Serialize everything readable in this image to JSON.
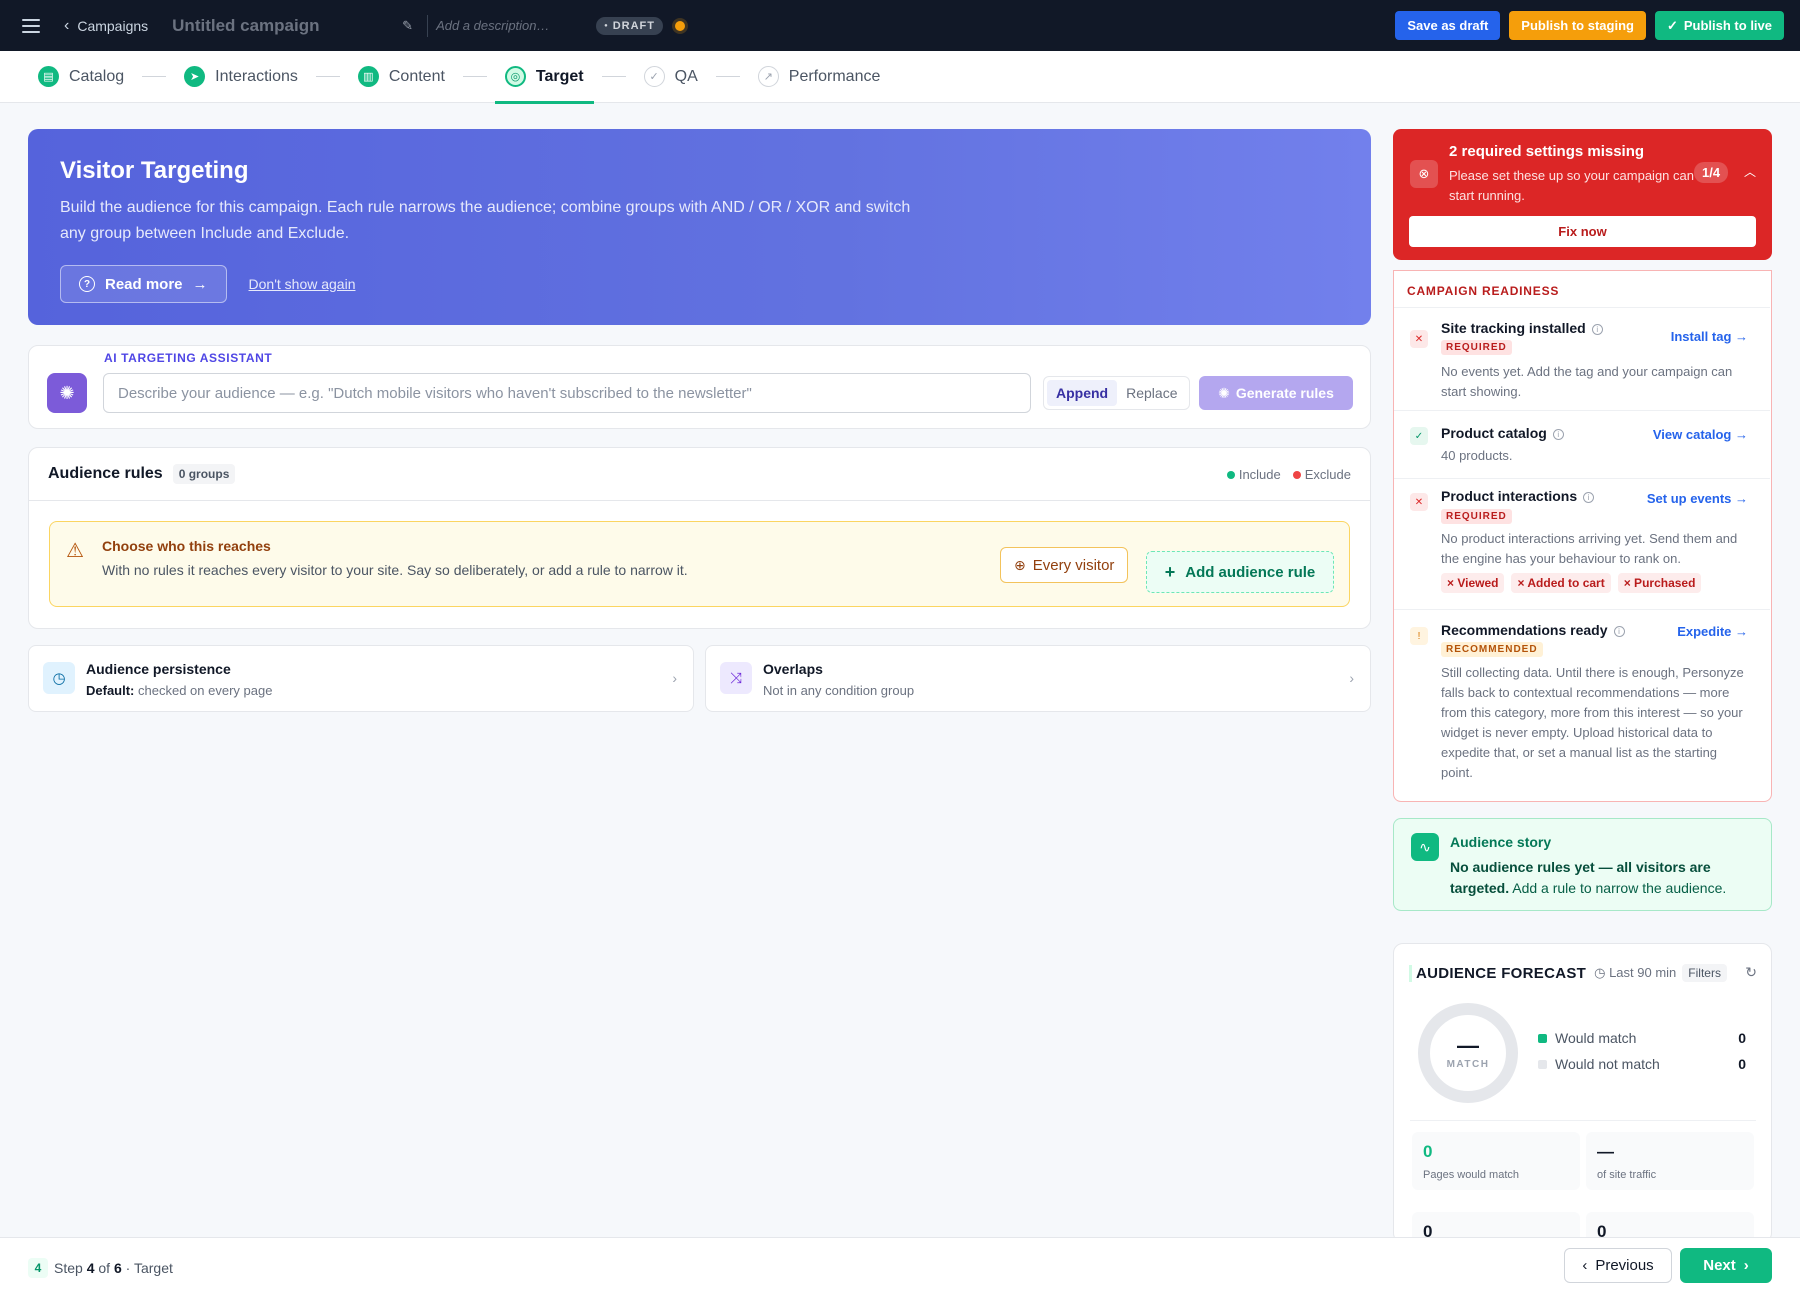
{
  "topbar": {
    "back_label": "Campaigns",
    "campaign_title": "Untitled campaign",
    "description_placeholder": "Add a description…",
    "status_badge": "DRAFT",
    "save_draft": "Save as draft",
    "publish_staging": "Publish to staging",
    "publish_live": "Publish to live"
  },
  "steps": [
    {
      "label": "Catalog",
      "state": "done",
      "icon": "catalog-icon"
    },
    {
      "label": "Interactions",
      "state": "done",
      "icon": "cursor-icon"
    },
    {
      "label": "Content",
      "state": "done",
      "icon": "document-icon"
    },
    {
      "label": "Target",
      "state": "current",
      "icon": "target-icon"
    },
    {
      "label": "QA",
      "state": "future",
      "icon": "check-circle-icon"
    },
    {
      "label": "Performance",
      "state": "future",
      "icon": "chart-icon"
    }
  ],
  "hero": {
    "title": "Visitor Targeting",
    "text": "Build the audience for this campaign. Each rule narrows the audience; combine groups with AND / OR / XOR and switch any group between Include and Exclude.",
    "read_more": "Read more",
    "dont_show": "Don't show again"
  },
  "ai": {
    "label": "AI TARGETING ASSISTANT",
    "placeholder": "Describe your audience — e.g. \"Dutch mobile visitors who haven't subscribed to the newsletter\"",
    "append": "Append",
    "replace": "Replace",
    "generate": "Generate rules"
  },
  "rules": {
    "title": "Audience rules",
    "groups_count": "0 groups",
    "include": "Include",
    "exclude": "Exclude",
    "warn_title": "Choose who this reaches",
    "warn_text": "With no rules it reaches every visitor to your site. Say so deliberately, or add a rule to narrow it.",
    "every_visitor": "Every visitor",
    "add_rule": "Add audience rule"
  },
  "persistence": {
    "title": "Audience persistence",
    "default_label": "Default:",
    "value": "checked on every page"
  },
  "overlaps": {
    "title": "Overlaps",
    "value": "Not in any condition group"
  },
  "alert": {
    "title": "2 required settings missing",
    "text": "Please set these up so your campaign can start running.",
    "counter": "1/4",
    "fix_now": "Fix now"
  },
  "readiness": {
    "header": "CAMPAIGN READINESS",
    "items": [
      {
        "title": "Site tracking installed",
        "tag": "REQUIRED",
        "link": "Install tag →",
        "body": "No events yet. Add the tag and your campaign can start showing."
      },
      {
        "title": "Product catalog",
        "tag": "",
        "link": "View catalog →",
        "body": "40 products."
      },
      {
        "title": "Product interactions",
        "tag": "REQUIRED",
        "link": "Set up events →",
        "body": "No product interactions arriving yet. Send them and the engine has your behaviour to rank on.",
        "chips": [
          "× Viewed",
          "× Added to cart",
          "× Purchased"
        ]
      },
      {
        "title": "Recommendations ready",
        "tag": "RECOMMENDED",
        "link": "Expedite →",
        "body": "Still collecting data. Until there is enough, Personyze falls back to contextual recommendations — more from this category, more from this interest — so your widget is never empty. Upload historical data to expedite that, or set a manual list as the starting point."
      }
    ]
  },
  "story": {
    "title": "Audience story",
    "bold": "No audience rules yet — all visitors are targeted.",
    "rest": " Add a rule to narrow the audience."
  },
  "forecast": {
    "title": "AUDIENCE FORECAST",
    "window": "Last 90 min",
    "filters": "Filters",
    "donut_value": "—",
    "donut_label": "MATCH",
    "would_match": "Would match",
    "would_match_val": "0",
    "would_not_match": "Would not match",
    "would_not_match_val": "0",
    "pages_match_val": "0",
    "pages_match_label": "Pages would match",
    "traffic_val": "—",
    "traffic_label": "of site traffic",
    "more_val_1": "0",
    "more_val_2": "0"
  },
  "footer": {
    "step_num": "4",
    "step_word": "Step",
    "step_cur": "4",
    "of_word": "of",
    "step_total": "6",
    "step_name": "· Target",
    "previous": "Previous",
    "next": "Next"
  },
  "colors": {
    "accent_green": "#10b981",
    "accent_blue": "#2563eb",
    "accent_orange": "#f59e0b",
    "danger": "#dc2626",
    "hero": "#5b6be0"
  }
}
